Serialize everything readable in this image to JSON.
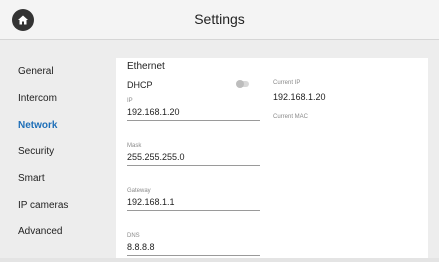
{
  "header": {
    "title": "Settings",
    "home_icon": "home-icon"
  },
  "sidebar": {
    "items": [
      {
        "label": "General",
        "active": false
      },
      {
        "label": "Intercom",
        "active": false
      },
      {
        "label": "Network",
        "active": true
      },
      {
        "label": "Security",
        "active": false
      },
      {
        "label": "Smart",
        "active": false
      },
      {
        "label": "IP cameras",
        "active": false
      },
      {
        "label": "Advanced",
        "active": false
      }
    ],
    "active_color": "#1e6fb8"
  },
  "network": {
    "section_title": "Ethernet",
    "dhcp_label": "DHCP",
    "dhcp_enabled": false,
    "fields": [
      {
        "label": "IP",
        "value": "192.168.1.20"
      },
      {
        "label": "Mask",
        "value": "255.255.255.0"
      },
      {
        "label": "Gateway",
        "value": "192.168.1.1"
      },
      {
        "label": "DNS",
        "value": "8.8.8.8"
      }
    ],
    "current_ip": {
      "label": "Current IP",
      "value": "192.168.1.20"
    },
    "current_mac": {
      "label": "Current MAC",
      "value": ""
    }
  }
}
